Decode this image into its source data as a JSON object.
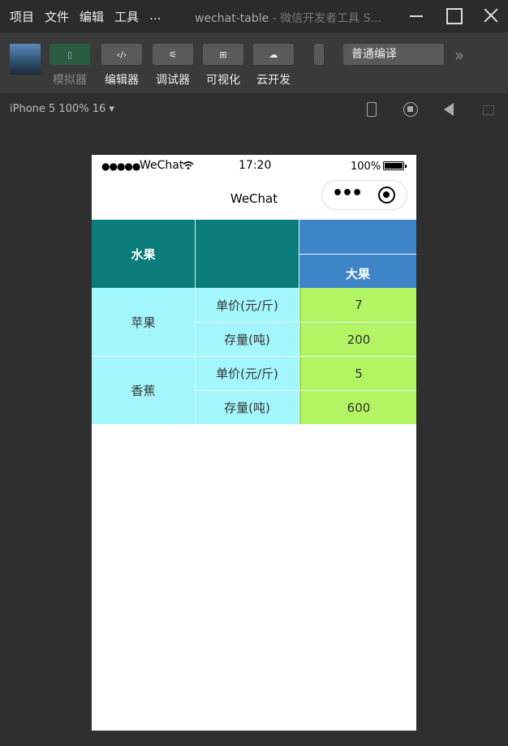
{
  "menu": [
    "项目",
    "文件",
    "编辑",
    "工具",
    "..."
  ],
  "window": {
    "title": "wechat-table",
    "title_suffix": " - 微信开发者工具 S..."
  },
  "toolbar": {
    "tools": [
      {
        "label": "模拟器",
        "icon": "phone-icon"
      },
      {
        "label": "编辑器",
        "icon": "code-icon",
        "glyph": "‹/›"
      },
      {
        "label": "调试器",
        "icon": "debug-icon",
        "glyph": "⚟"
      },
      {
        "label": "可视化",
        "icon": "layout-icon",
        "glyph": "⊞"
      },
      {
        "label": "云开发",
        "icon": "cloud-icon",
        "glyph": "☁"
      }
    ],
    "compile_mode": "普通编译",
    "more": "»"
  },
  "device": {
    "label": "iPhone 5 100% 16 ▾"
  },
  "phone": {
    "signal": "●●●●●",
    "carrier": "WeChat",
    "time": "17:20",
    "battery": "100%",
    "nav_title": "WeChat",
    "capsule_dots": "•••"
  },
  "table": {
    "header": {
      "col1": "水果",
      "col2": "",
      "col3_top": "",
      "col3_bottom": "大果"
    },
    "groups": [
      {
        "name": "苹果",
        "rows": [
          {
            "label": "单价(元/斤)",
            "value": "7"
          },
          {
            "label": "存量(吨)",
            "value": "200"
          }
        ]
      },
      {
        "name": "香蕉",
        "rows": [
          {
            "label": "单价(元/斤)",
            "value": "5"
          },
          {
            "label": "存量(吨)",
            "value": "600"
          }
        ]
      }
    ],
    "colors": {
      "header_teal": "#0b7c7c",
      "header_blue": "#3d84c8",
      "body_cyan": "#a3f6fc",
      "body_lime": "#b2f461"
    }
  }
}
